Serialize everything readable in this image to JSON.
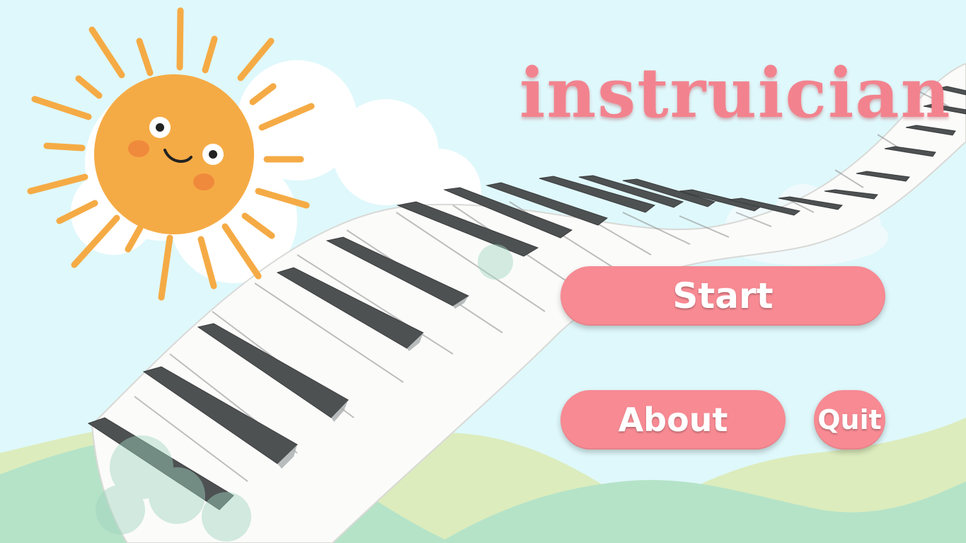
{
  "app": {
    "title": "instruician"
  },
  "menu": {
    "start_label": "Start",
    "about_label": "About",
    "quit_label": "Quit"
  },
  "colors": {
    "sky": "#dff8fb",
    "button": "#f78a93",
    "title": "#f2838e",
    "sun": "#f5ab45",
    "hills": "#b5e3c8",
    "hills_light": "#dcecbd"
  },
  "icons": {
    "sun": "smiling-sun-icon",
    "piano": "piano-keys-illustration"
  }
}
